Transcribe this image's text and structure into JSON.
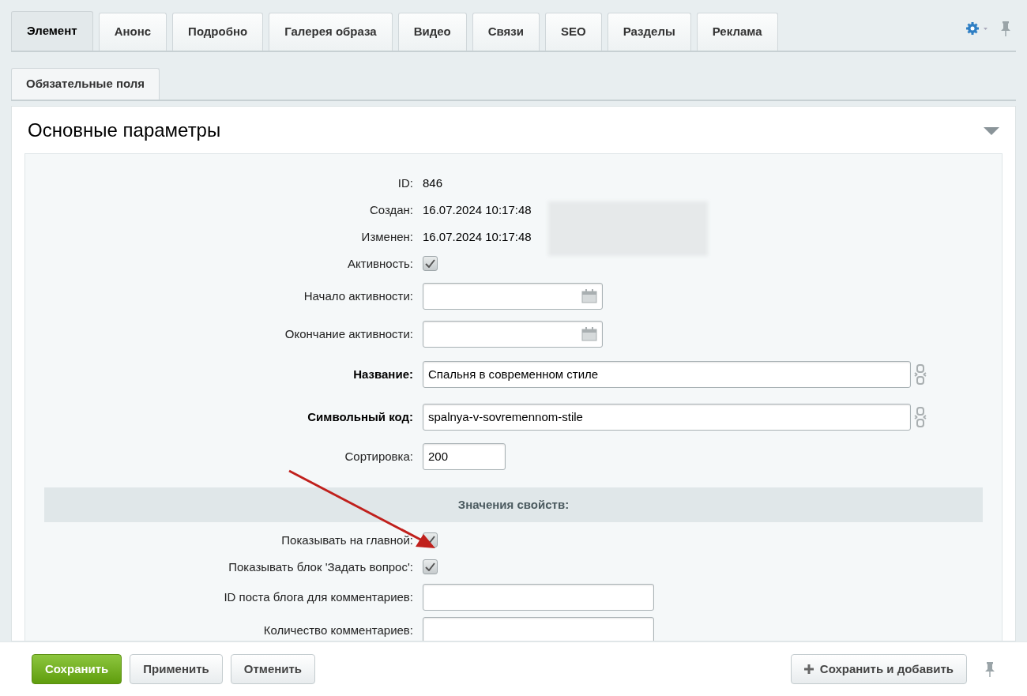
{
  "tabs": [
    {
      "label": "Элемент",
      "selected": true
    },
    {
      "label": "Анонс",
      "selected": false
    },
    {
      "label": "Подробно",
      "selected": false
    },
    {
      "label": "Галерея образа",
      "selected": false
    },
    {
      "label": "Видео",
      "selected": false
    },
    {
      "label": "Связи",
      "selected": false
    },
    {
      "label": "SEO",
      "selected": false
    },
    {
      "label": "Разделы",
      "selected": false
    },
    {
      "label": "Реклама",
      "selected": false
    }
  ],
  "subtabs": [
    {
      "label": "Обязательные поля",
      "selected": true
    }
  ],
  "section": {
    "title": "Основные параметры",
    "expanded": true,
    "rows": [
      {
        "kind": "static",
        "label": "ID:",
        "value": "846"
      },
      {
        "kind": "static",
        "label": "Создан:",
        "value": "16.07.2024 10:17:48"
      },
      {
        "kind": "static",
        "label": "Изменен:",
        "value": "16.07.2024 10:17:48"
      },
      {
        "kind": "checkbox",
        "label": "Активность:",
        "checked": true
      },
      {
        "kind": "date",
        "label": "Начало активности:"
      },
      {
        "kind": "date",
        "label": "Окончание активности:"
      },
      {
        "kind": "wide",
        "label": "Название:",
        "required": true,
        "value": "Спальня в современном стиле",
        "link_toggle": true
      },
      {
        "kind": "wide",
        "label": "Символьный код:",
        "required": true,
        "value": "spalnya-v-sovremennom-stile",
        "link_toggle": true
      },
      {
        "kind": "short",
        "label": "Сортировка:",
        "value": "200"
      },
      {
        "kind": "header",
        "label": "Значения свойств:"
      },
      {
        "kind": "checkbox",
        "label": "Показывать на главной:",
        "checked": true
      },
      {
        "kind": "checkbox",
        "label": "Показывать блок 'Задать вопрос':",
        "checked": true
      },
      {
        "kind": "medium",
        "label": "ID поста блога для комментариев:"
      },
      {
        "kind": "medium",
        "label": "Количество комментариев:"
      }
    ]
  },
  "footer": {
    "buttons": [
      {
        "label": "Сохранить",
        "kind": "primary"
      },
      {
        "label": "Применить",
        "kind": "plain"
      },
      {
        "label": "Отменить",
        "kind": "plain"
      }
    ],
    "add_button": {
      "label": "Сохранить и добавить"
    }
  }
}
